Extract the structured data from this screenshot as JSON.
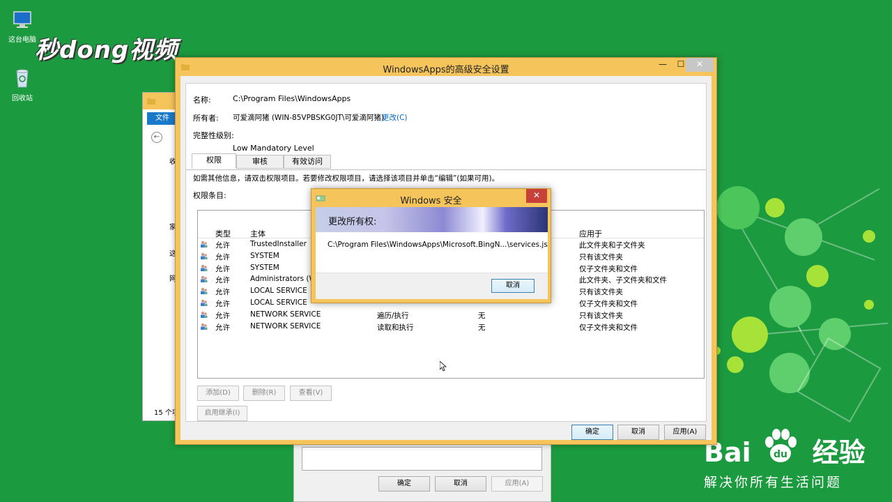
{
  "desktop": {
    "icons": [
      {
        "label": "这台电脑"
      },
      {
        "label": "回收站"
      }
    ],
    "watermark_logo": "秒dong视频",
    "baidu_brand": {
      "main": "Bai",
      "du": "du",
      "suffix": "经验",
      "slogan": "解决你所有生活问题"
    }
  },
  "explorer": {
    "file_tab": "文件",
    "nav_items": [
      "收",
      "家",
      "这",
      "网"
    ],
    "status": "15 个项"
  },
  "back_dialog": {
    "ok": "确定",
    "cancel": "取消",
    "apply": "应用(A)"
  },
  "main_window": {
    "title": "WindowsApps的高级安全设置",
    "controls": {
      "minimize": "—",
      "maximize": "☐",
      "close": "✕"
    },
    "name_label": "名称:",
    "name_value": "C:\\Program Files\\WindowsApps",
    "owner_label": "所有者:",
    "owner_value": "可爱滴阿猪 (WIN-85VPBSKG0JT\\可爱滴阿猪)",
    "owner_change": "更改(C)",
    "integrity_label": "完整性级别:",
    "integrity_value": "Low Mandatory Level",
    "tabs": [
      "权限",
      "审核",
      "有效访问"
    ],
    "info_text": "如需其他信息，请双击权限项目。若要修改权限项目，请选择该项目并单击“编辑”(如果可用)。",
    "entries_label": "权限条目:",
    "columns": {
      "type": "类型",
      "principal": "主体",
      "applies": "应用于"
    },
    "rows": [
      {
        "type": "允许",
        "principal": "TrustedInstaller",
        "access": "",
        "inherited": "",
        "applies": "此文件夹和子文件夹"
      },
      {
        "type": "允许",
        "principal": "SYSTEM",
        "access": "",
        "inherited": "",
        "applies": "只有该文件夹"
      },
      {
        "type": "允许",
        "principal": "SYSTEM",
        "access": "",
        "inherited": "",
        "applies": "仅子文件夹和文件"
      },
      {
        "type": "允许",
        "principal": "Administrators (WIN",
        "access": "",
        "inherited": "",
        "applies": "此文件夹、子文件夹和文件"
      },
      {
        "type": "允许",
        "principal": "LOCAL SERVICE",
        "access": "",
        "inherited": "",
        "applies": "只有该文件夹"
      },
      {
        "type": "允许",
        "principal": "LOCAL SERVICE",
        "access": "",
        "inherited": "",
        "applies": "仅子文件夹和文件"
      },
      {
        "type": "允许",
        "principal": "NETWORK SERVICE",
        "access": "遍历/执行",
        "inherited": "无",
        "applies": "只有该文件夹"
      },
      {
        "type": "允许",
        "principal": "NETWORK SERVICE",
        "access": "读取和执行",
        "inherited": "无",
        "applies": "仅子文件夹和文件"
      }
    ],
    "add": "添加(D)",
    "remove": "删除(R)",
    "view": "查看(V)",
    "enable_inheritance": "启用继承(I)",
    "ok": "确定",
    "cancel": "取消",
    "apply": "应用(A)"
  },
  "security_dialog": {
    "title": "Windows 安全",
    "close": "✕",
    "heading": "更改所有权:",
    "path": "C:\\Program Files\\WindowsApps\\Microsoft.BingN...\\services.js",
    "cancel": "取消"
  },
  "colors": {
    "desktop_green": "#1c9a3f",
    "window_frame": "#f5c45b",
    "link_blue": "#0066cc"
  }
}
